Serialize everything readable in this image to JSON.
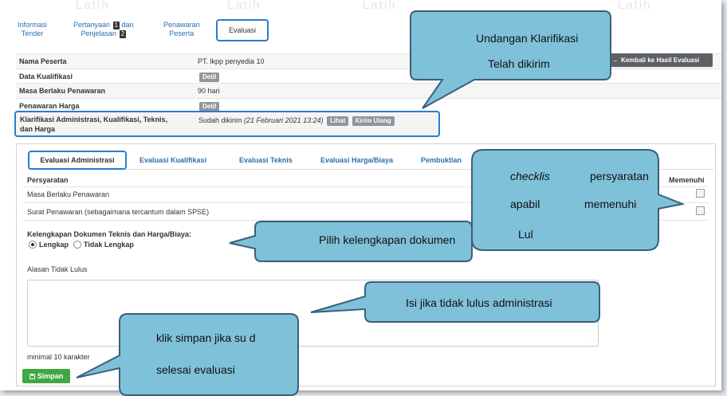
{
  "watermark": "Latih",
  "top_tabs": [
    {
      "line1": "Informasi",
      "line2": "Tender"
    },
    {
      "line1": "Pertanyaan",
      "badge1": "1",
      "line1b": "dan",
      "line2": "Penjelasan",
      "badge2": "2"
    },
    {
      "line1": "Penawaran",
      "line2": "Peserta"
    },
    {
      "label": "Evaluasi"
    }
  ],
  "info_rows": [
    {
      "key": "Nama Peserta",
      "value": "PT. lkpp penyedia 10"
    },
    {
      "key": "Data Kualifikasi",
      "button": "Detil"
    },
    {
      "key": "Masa Berlaku Penawaran",
      "value": "90 hari"
    },
    {
      "key": "Penawaran Harga",
      "button": "Detil"
    }
  ],
  "back_button": "← Kembali ke Hasil Evaluasi",
  "klarifikasi": {
    "key": "Klarifikasi Administrasi, Kualifikasi, Teknis, dan Harga",
    "status": "Sudah dikirim",
    "date": "(21 Februari 2021 13:24)",
    "view_button": "Lihat",
    "resend_button": "Kirim Ulang"
  },
  "eval_tabs": [
    "Evaluasi Administrasi",
    "Evaluasi Kualifikasi",
    "Evaluasi Teknis",
    "Evaluasi Harga/Biaya",
    "Pembuktian"
  ],
  "requirements": {
    "header": "Persyaratan",
    "check_header": "Memenuhi",
    "items": [
      "Masa Berlaku Penawaran",
      "Surat Penawaran (sebagaimana tercantum dalam SPSE)"
    ]
  },
  "completeness": {
    "label": "Kelengkapan Dokumen Teknis dan Harga/Biaya:",
    "option_complete": "Lengkap",
    "option_incomplete": "Tidak Lengkap"
  },
  "reason": {
    "label": "Alasan Tidak Lulus",
    "hint": "minimal 10 karakter"
  },
  "save_button": "Simpan",
  "callouts": {
    "invitation_line1": "Undangan Klarifikasi",
    "invitation_line2": "Telah dikirim",
    "checklist_word": "checklis",
    "checklist_rest": "persyaratan",
    "checklist_line2a": "apabil",
    "checklist_line2b": "memenuhi",
    "checklist_line3": "Lul",
    "completeness": "Pilih kelengkapan dokumen",
    "fail_reason": "Isi jika tidak lulus administrasi",
    "save_line1": "klik simpan jika su d",
    "save_line2": "selesai evaluasi"
  },
  "colors": {
    "callout_fill": "#7fc1d9",
    "callout_stroke": "#3b5f7a",
    "highlight": "#2b7ccf",
    "save": "#3fa744"
  }
}
